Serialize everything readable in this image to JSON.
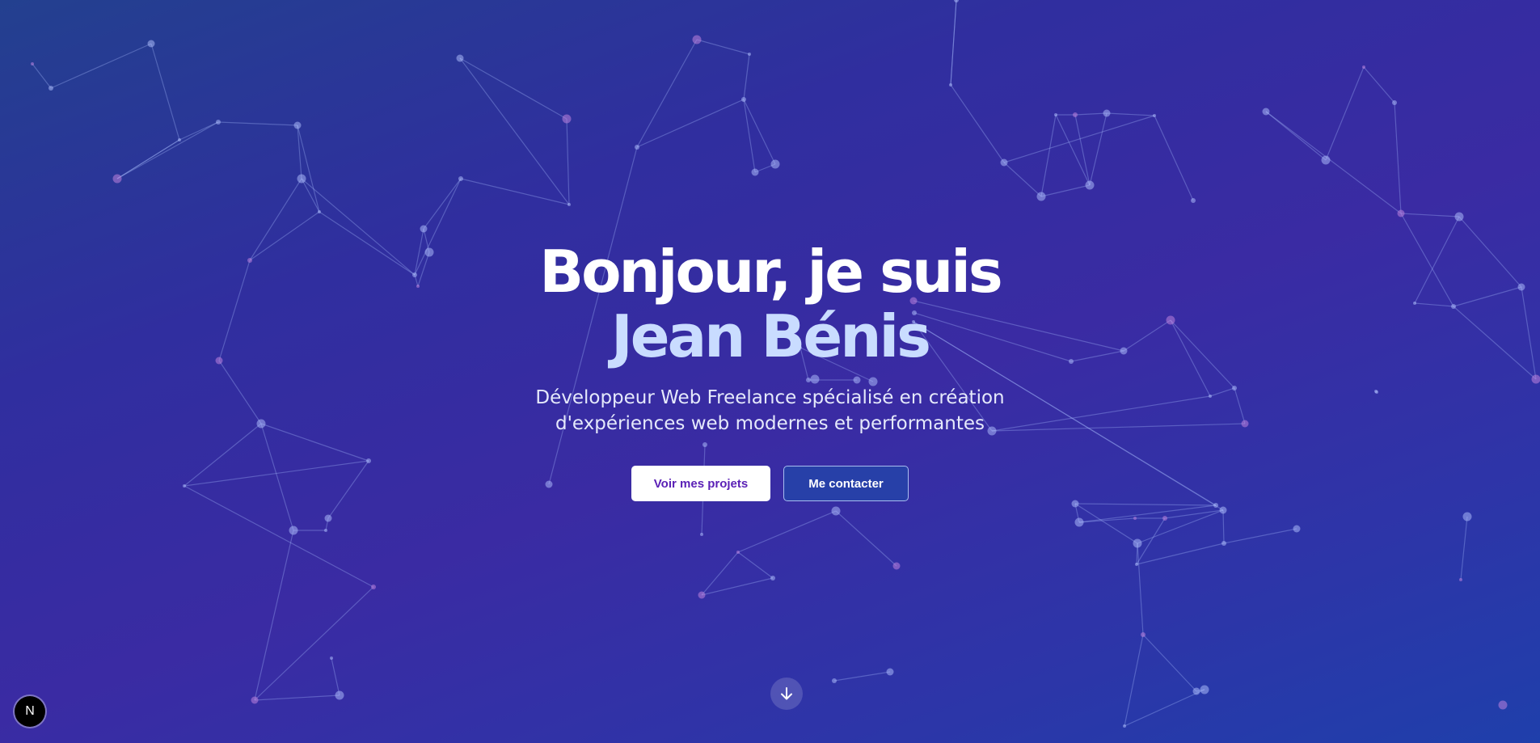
{
  "hero": {
    "title_line_1": "Bonjour, je suis",
    "title_line_2": "Jean Bénis",
    "subtitle_line_1": "Développeur Web Freelance spécialisé en création",
    "subtitle_line_2": "d'expériences web modernes et performantes"
  },
  "buttons": {
    "projects_label": "Voir mes projets",
    "contact_label": "Me contacter"
  },
  "icons": {
    "scroll": "arrow-down-icon",
    "badge": "nextjs-logo-icon"
  },
  "badge": {
    "letter": "N"
  },
  "colors": {
    "background_start": "#23408f",
    "background_mid": "#3a2ba3",
    "background_end": "#1f3fab",
    "title_accent": "#c9dcff",
    "primary_button_text": "#5b21b6",
    "secondary_button_bg": "#2740a8"
  }
}
